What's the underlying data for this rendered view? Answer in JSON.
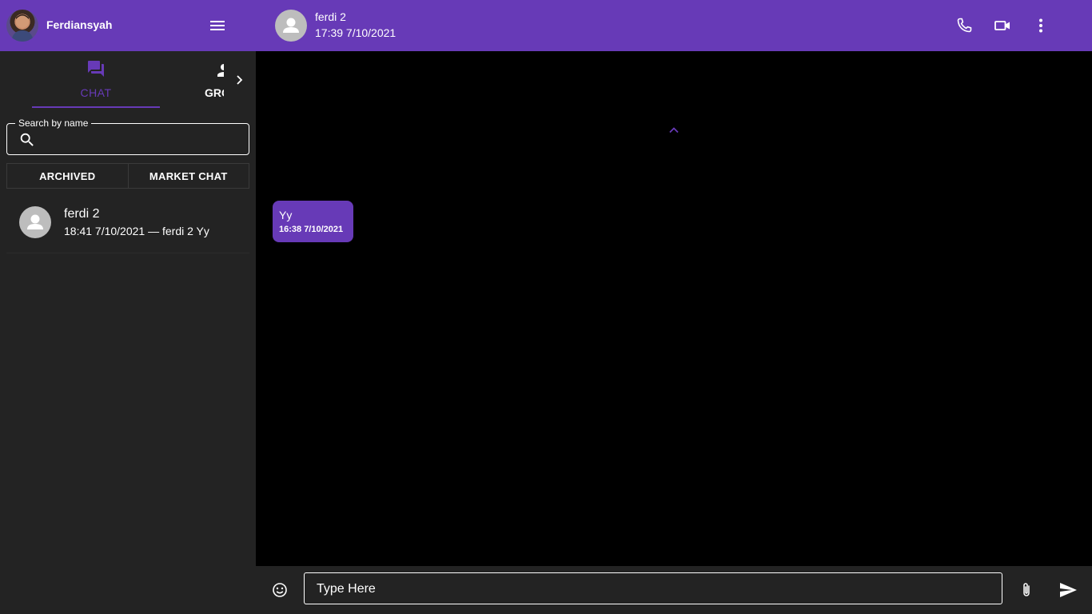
{
  "sidebar": {
    "user": {
      "name": "Ferdiansyah"
    },
    "tabs": [
      {
        "label": "CHAT",
        "icon": "forum-icon",
        "active": true
      },
      {
        "label": "GRC",
        "icon": "person-icon",
        "active": false
      }
    ],
    "search": {
      "legend": "Search by name",
      "placeholder": "",
      "value": ""
    },
    "filters": [
      {
        "label": "ARCHIVED"
      },
      {
        "label": "MARKET CHAT"
      }
    ],
    "chats": [
      {
        "name": "ferdi 2",
        "subtitle": "18:41 7/10/2021 — ferdi 2 Yy"
      }
    ]
  },
  "conversation": {
    "contact": {
      "name": "ferdi 2",
      "status": "17:39 7/10/2021"
    },
    "messages": [
      {
        "text": "Yy",
        "time": "16:38 7/10/2021"
      }
    ],
    "composer": {
      "placeholder": "Type Here",
      "value": ""
    }
  },
  "colors": {
    "accent": "#673ab7",
    "sidebar_bg": "#232323",
    "chat_bg": "#000000",
    "avatar_placeholder": "#bdbdbd"
  }
}
